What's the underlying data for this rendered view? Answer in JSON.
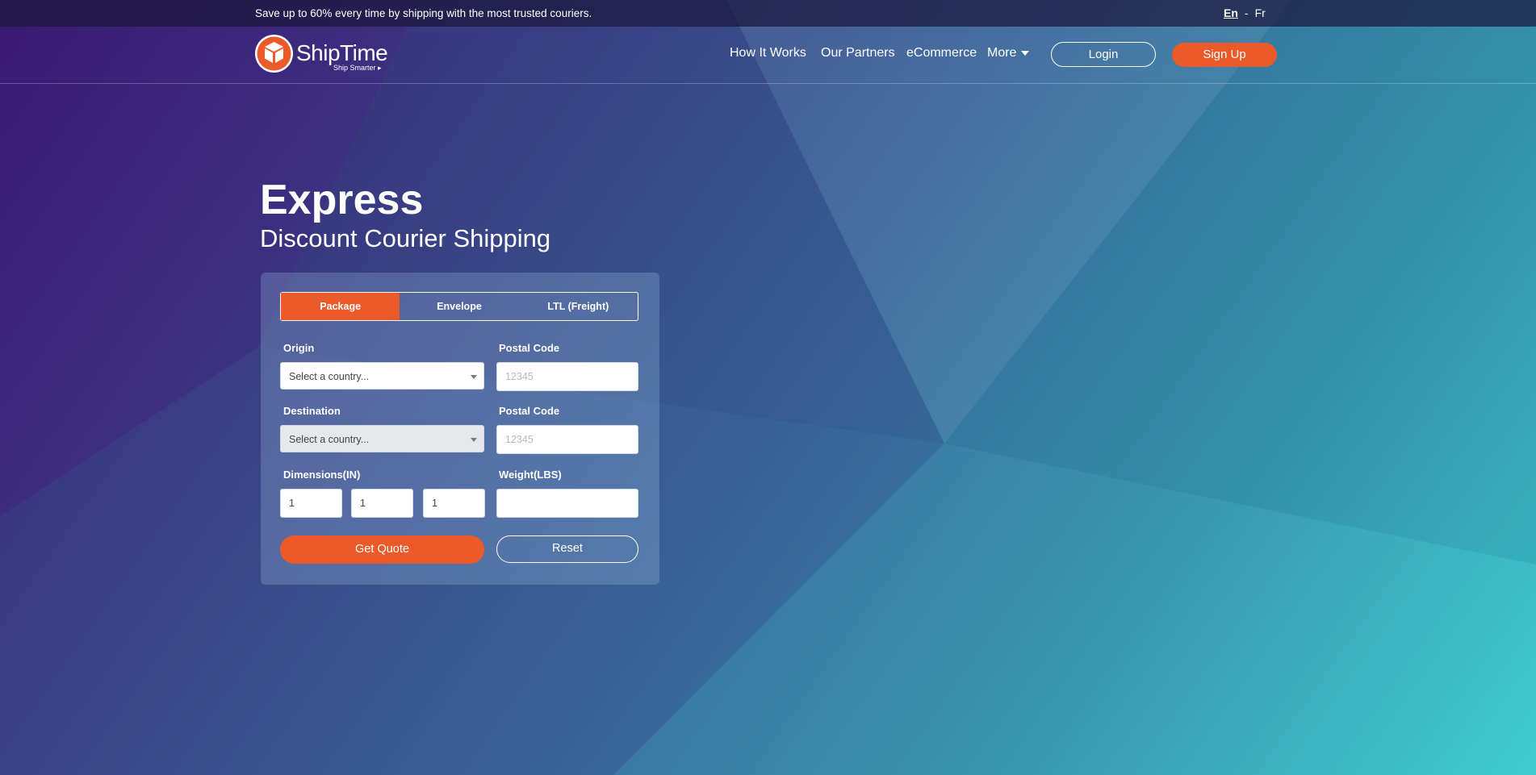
{
  "topbar": {
    "promo": "Save up to 60% every time by shipping with the most trusted couriers.",
    "lang_en": "En",
    "lang_sep": "-",
    "lang_fr": "Fr"
  },
  "brand": {
    "name": "ShipTime",
    "tagline": "Ship Smarter",
    "logo_icon": "package-box-icon",
    "accent": "#ec5a2a"
  },
  "nav": {
    "items": [
      {
        "label": "How It Works"
      },
      {
        "label": "Our Partners"
      },
      {
        "label": "eCommerce"
      },
      {
        "label": "More"
      }
    ],
    "login": "Login",
    "signup": "Sign Up"
  },
  "hero": {
    "title": "Express",
    "subtitle": "Discount Courier Shipping"
  },
  "quote_form": {
    "tabs": [
      {
        "label": "Package",
        "active": true
      },
      {
        "label": "Envelope",
        "active": false
      },
      {
        "label": "LTL (Freight)",
        "active": false
      }
    ],
    "origin_label": "Origin",
    "origin_select": "Select a country...",
    "origin_postal_label": "Postal Code",
    "origin_postal_placeholder": "12345",
    "destination_label": "Destination",
    "destination_select": "Select a country...",
    "destination_postal_label": "Postal Code",
    "destination_postal_placeholder": "12345",
    "dimensions_label": "Dimensions(IN)",
    "dim_length": "1",
    "dim_width": "1",
    "dim_height": "1",
    "weight_label": "Weight(LBS)",
    "weight_value": "",
    "get_quote": "Get Quote",
    "reset": "Reset"
  }
}
